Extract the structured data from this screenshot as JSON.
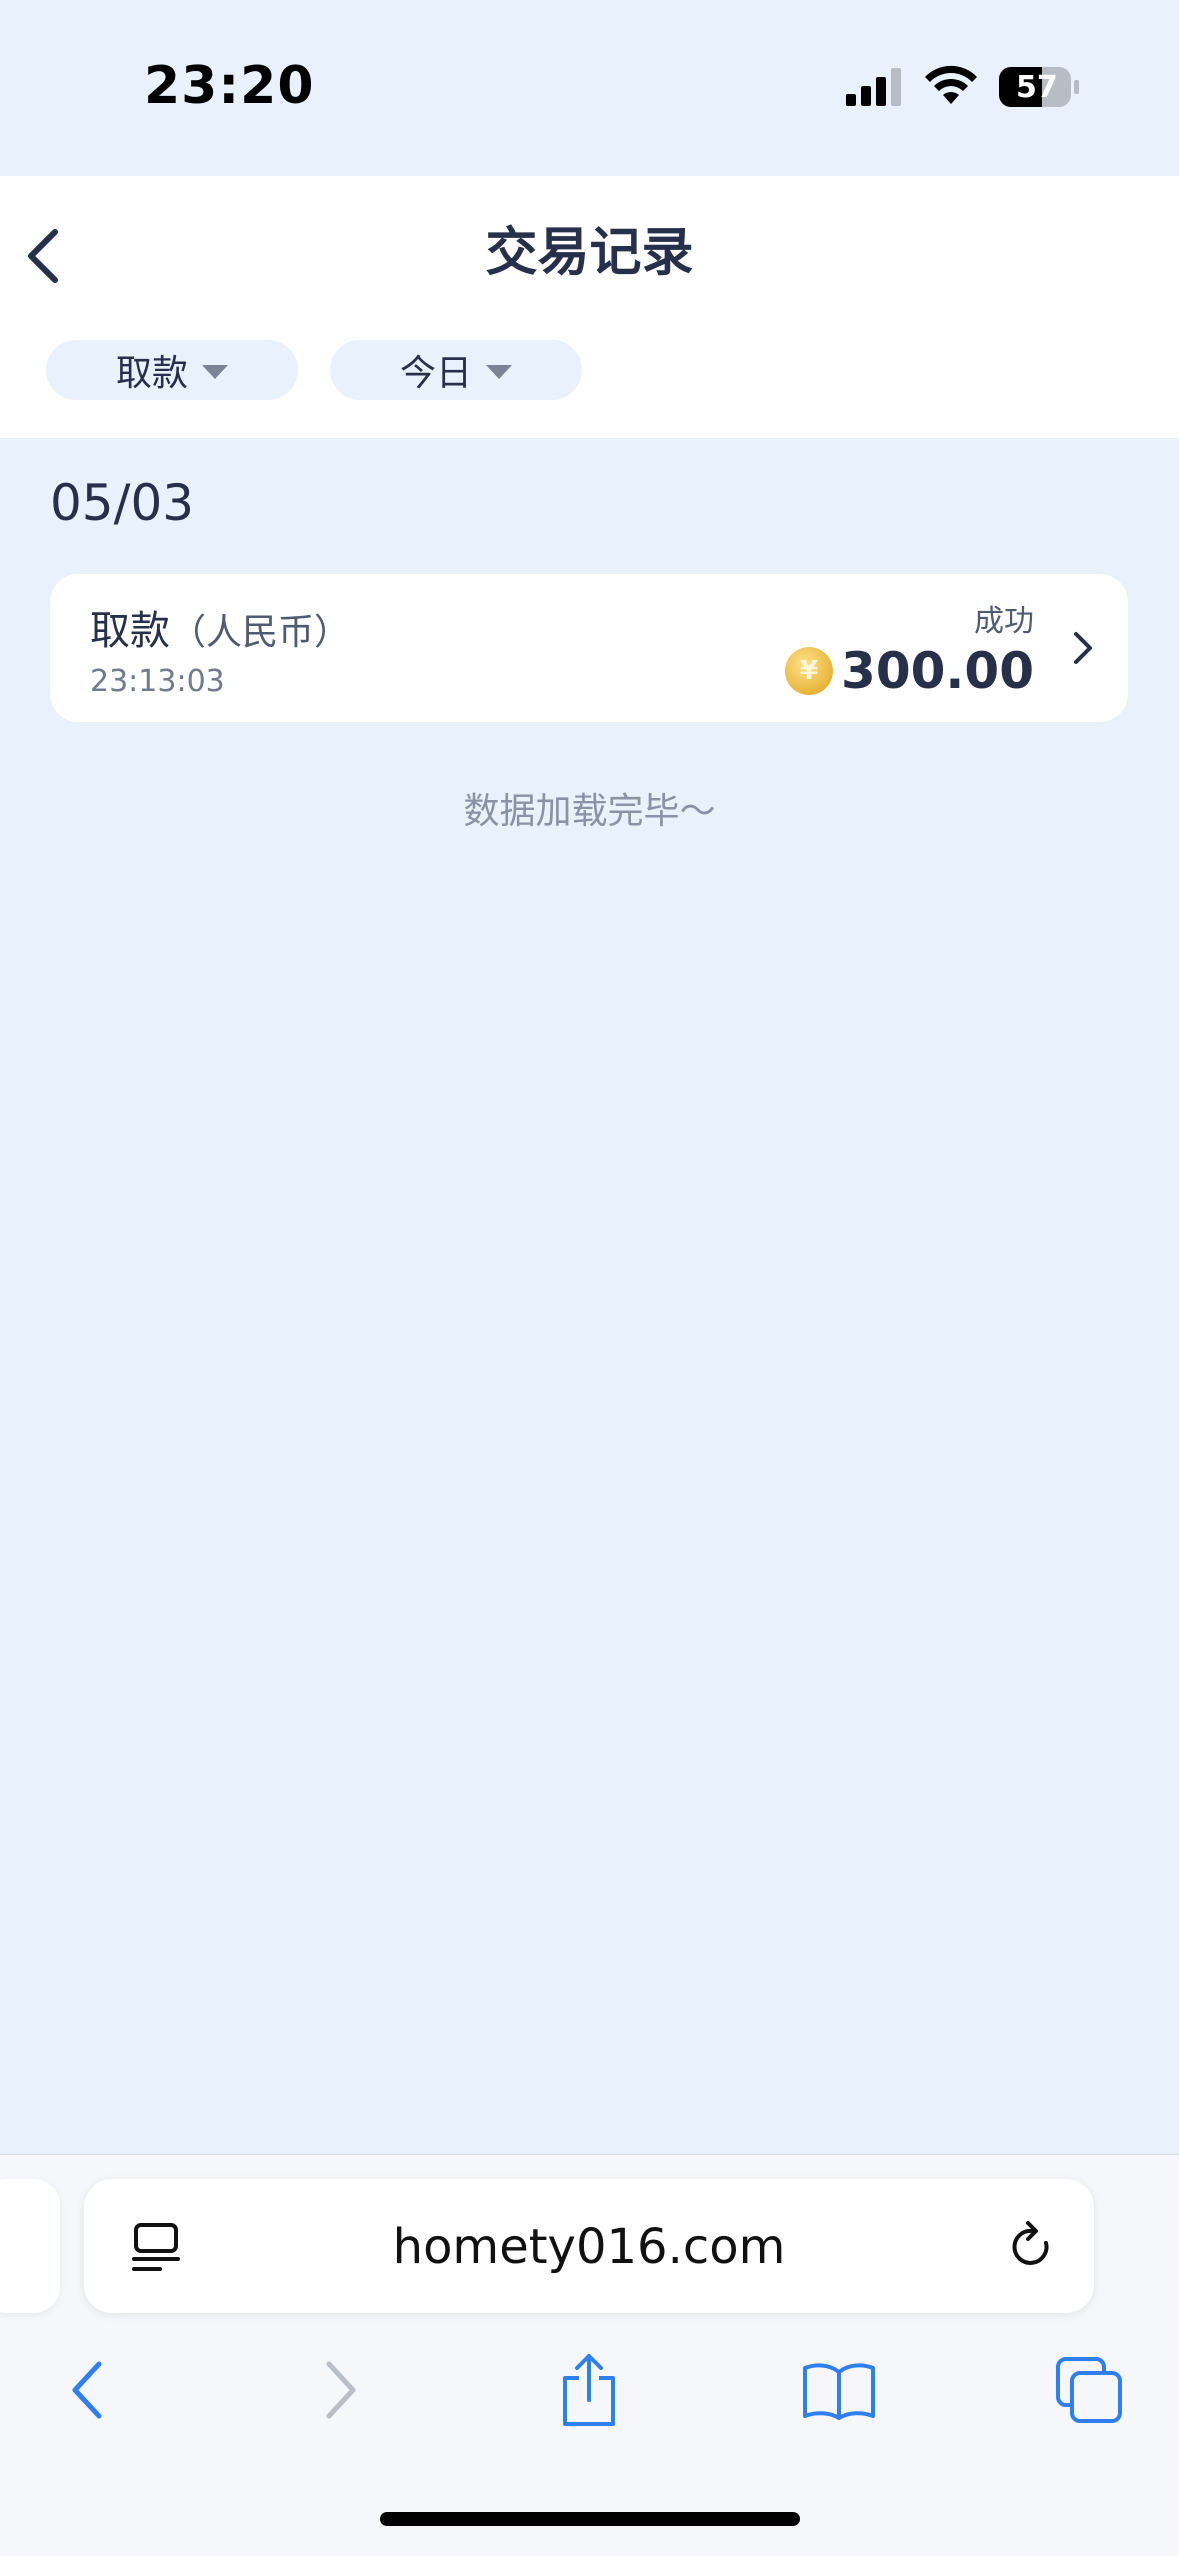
{
  "status_bar": {
    "time": "23:20",
    "battery": "57"
  },
  "header": {
    "title": "交易记录",
    "back_icon": "chevron-left-icon"
  },
  "filters": [
    {
      "label": "取款"
    },
    {
      "label": "今日"
    }
  ],
  "list": {
    "date": "05/03",
    "records": [
      {
        "title": "取款",
        "currency_note": "（人民币）",
        "time": "23:13:03",
        "status": "成功",
        "amount": "300.00",
        "coin_symbol": "¥"
      }
    ],
    "end_text": "数据加载完毕～"
  },
  "browser": {
    "url": "homety016.com"
  },
  "colors": {
    "accent": "#2f7ff0",
    "text": "#27304a",
    "page_bg": "#e9f1fc"
  }
}
